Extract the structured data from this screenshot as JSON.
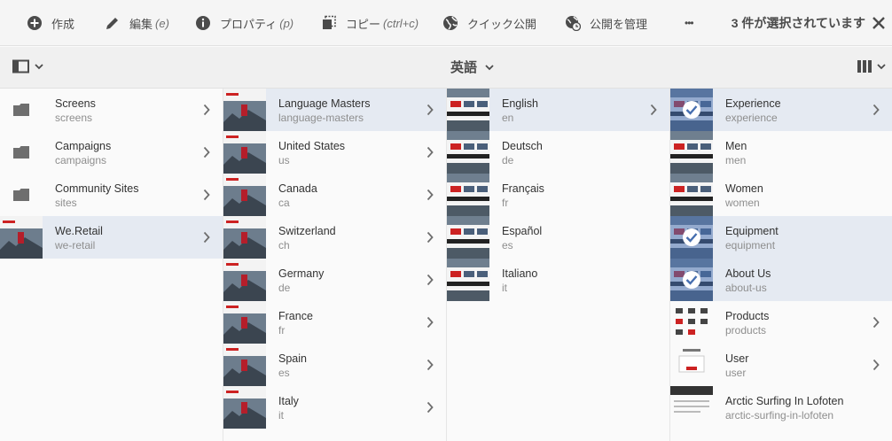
{
  "toolbar": {
    "create_label": "作成",
    "edit_label": "編集",
    "edit_shortcut": "(e)",
    "properties_label": "プロパティ",
    "properties_shortcut": "(p)",
    "copy_label": "コピー",
    "copy_shortcut": "(ctrl+c)",
    "quick_publish_label": "クイック公開",
    "manage_publication_label": "公開を管理",
    "more_label": "•••",
    "selection_count": "3 件が選択されています"
  },
  "subbar": {
    "language": "英語"
  },
  "columns": [
    {
      "items": [
        {
          "title": "Screens",
          "sub": "screens",
          "kind": "folder"
        },
        {
          "title": "Campaigns",
          "sub": "campaigns",
          "kind": "folder"
        },
        {
          "title": "Community Sites",
          "sub": "sites",
          "kind": "folder"
        },
        {
          "title": "We.Retail",
          "sub": "we-retail",
          "kind": "retail",
          "active": true
        }
      ]
    },
    {
      "items": [
        {
          "title": "Language Masters",
          "sub": "language-masters",
          "active": true
        },
        {
          "title": "United States",
          "sub": "us"
        },
        {
          "title": "Canada",
          "sub": "ca"
        },
        {
          "title": "Switzerland",
          "sub": "ch"
        },
        {
          "title": "Germany",
          "sub": "de"
        },
        {
          "title": "France",
          "sub": "fr"
        },
        {
          "title": "Spain",
          "sub": "es"
        },
        {
          "title": "Italy",
          "sub": "it"
        }
      ]
    },
    {
      "items": [
        {
          "title": "English",
          "sub": "en",
          "active": true
        },
        {
          "title": "Deutsch",
          "sub": "de"
        },
        {
          "title": "Français",
          "sub": "fr"
        },
        {
          "title": "Español",
          "sub": "es"
        },
        {
          "title": "Italiano",
          "sub": "it"
        }
      ]
    },
    {
      "items": [
        {
          "title": "Experience",
          "sub": "experience",
          "selected": true
        },
        {
          "title": "Men",
          "sub": "men"
        },
        {
          "title": "Women",
          "sub": "women"
        },
        {
          "title": "Equipment",
          "sub": "equipment",
          "selected": true
        },
        {
          "title": "About Us",
          "sub": "about-us",
          "selected": true
        },
        {
          "title": "Products",
          "sub": "products"
        },
        {
          "title": "User",
          "sub": "user"
        },
        {
          "title": "Arctic Surfing In Lofoten",
          "sub": "arctic-surfing-in-lofoten"
        }
      ]
    }
  ],
  "colors": {
    "active_row": "#e5eaf2",
    "selection_overlay": "#466eaf"
  }
}
